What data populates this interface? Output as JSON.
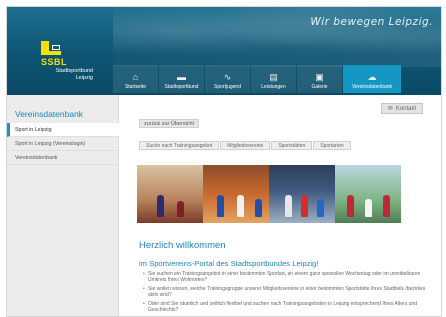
{
  "header": {
    "slogan": "Wir bewegen Leipzig.",
    "logo": {
      "name": "SSBL",
      "subtitle": "Stadtsportbund Leipzig"
    }
  },
  "nav": {
    "tabs": [
      {
        "label": "Startseite",
        "icon": "home-icon",
        "glyph": "⌂"
      },
      {
        "label": "Stadtsportbund",
        "icon": "ssbl-logo-icon",
        "glyph": "▬"
      },
      {
        "label": "Sportjugend",
        "icon": "sportjugend-icon",
        "glyph": "∿"
      },
      {
        "label": "Leistungen",
        "icon": "list-icon",
        "glyph": "▤"
      },
      {
        "label": "Galerie",
        "icon": "image-icon",
        "glyph": "▣"
      },
      {
        "label": "Vereinsdatenbank",
        "icon": "database-icon",
        "glyph": "☁"
      }
    ],
    "active_index": 5
  },
  "sidebar": {
    "title": "Vereinsdatenbank",
    "items": [
      {
        "label": "Sport in Leipzig"
      },
      {
        "label": "Sport in Leipzig (Vereinslogin)"
      },
      {
        "label": "Vereinsdatenbank"
      }
    ]
  },
  "main": {
    "kontakt": "Kontakt",
    "back": "zurück zur Übersicht",
    "subtabs": [
      {
        "label": "Suche nach Trainingsangebot"
      },
      {
        "label": "Mitgliedsvereine"
      },
      {
        "label": "Sportstätten"
      },
      {
        "label": "Sportarten"
      }
    ],
    "heading1": "Herzlich willkommen",
    "heading2": "im Sportvereins-Portal des Stadtsportbundes Leipzig!",
    "bullets": [
      "Sie suchen ein Trainingsangebot in einer bestimmten Sportart, an einem ganz speziellen Wochentag oder im unmittelbaren Umkreis Ihres Wohnortes?",
      "Sie wollen wissen, welche Trainingsgruppe unserer Mitgliedsvereine in einer bestimmten Sportstätte Ihres Stadtteils /bezirkes aktiv sind?",
      "Oder sind Sie räumlich und zeitlich flexibel und suchen nach Trainingsangeboten in Leipzig entsprechend Ihres Alters und Geschlechts?"
    ]
  },
  "colors": {
    "brand_blue": "#1c86b5",
    "accent": "#1597c4",
    "logo_yellow": "#f6e000",
    "header_bg": "#0e5573"
  }
}
